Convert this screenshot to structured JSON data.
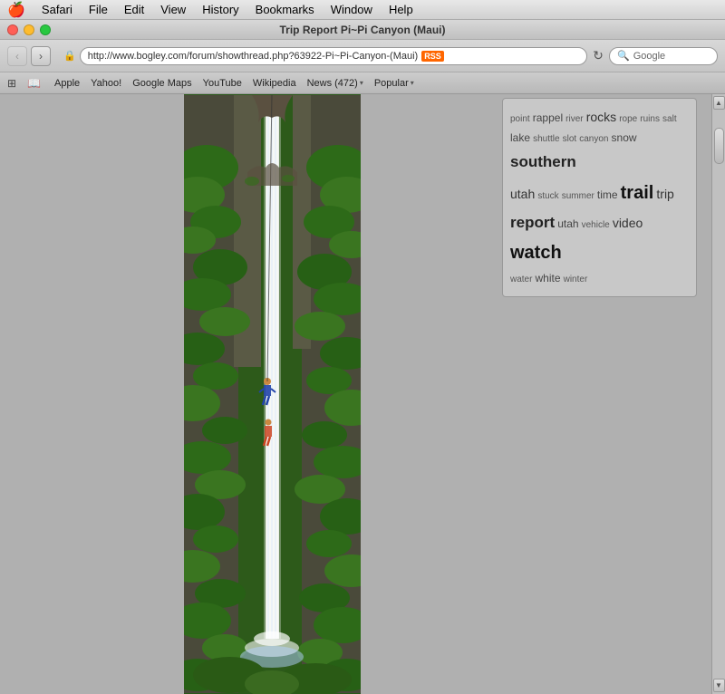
{
  "menubar": {
    "apple": "🍎",
    "items": [
      "Safari",
      "File",
      "Edit",
      "View",
      "History",
      "Bookmarks",
      "Window",
      "Help"
    ]
  },
  "titlebar": {
    "title": "Trip Report Pi~Pi Canyon (Maui)"
  },
  "toolbar": {
    "back_label": "‹",
    "forward_label": "›",
    "address": "http://www.bogley.com/forum/showthread.php?63922-Pi~Pi-Canyon-(Maui)",
    "rss_label": "RSS",
    "refresh_label": "↻",
    "search_placeholder": "Google",
    "search_icon": "🔍"
  },
  "bookmarks": {
    "icons": [
      "⊞",
      "📖"
    ],
    "items": [
      "Apple",
      "Yahoo!",
      "Google Maps",
      "YouTube",
      "Wikipedia"
    ],
    "dropdown_items": [
      {
        "label": "News (472)",
        "has_dropdown": true
      },
      {
        "label": "Popular",
        "has_dropdown": true
      }
    ]
  },
  "tag_cloud": {
    "tags": [
      {
        "word": "point",
        "size": "sm"
      },
      {
        "word": "rappel",
        "size": "md"
      },
      {
        "word": "river",
        "size": "sm"
      },
      {
        "word": "rocks",
        "size": "lg"
      },
      {
        "word": "rope",
        "size": "sm"
      },
      {
        "word": "ruins",
        "size": "sm"
      },
      {
        "word": "salt",
        "size": "sm"
      },
      {
        "word": "lake",
        "size": "md"
      },
      {
        "word": "shuttle",
        "size": "sm"
      },
      {
        "word": "slot",
        "size": "sm"
      },
      {
        "word": "canyon",
        "size": "sm"
      },
      {
        "word": "snow",
        "size": "md"
      },
      {
        "word": "southern",
        "size": "xl"
      },
      {
        "word": "utah",
        "size": "lg"
      },
      {
        "word": "stuck",
        "size": "sm"
      },
      {
        "word": "summer",
        "size": "sm"
      },
      {
        "word": "time",
        "size": "md"
      },
      {
        "word": "trail",
        "size": "xxl"
      },
      {
        "word": "trip",
        "size": "lg"
      },
      {
        "word": "report",
        "size": "xl"
      },
      {
        "word": "utah",
        "size": "md"
      },
      {
        "word": "vehicle",
        "size": "sm"
      },
      {
        "word": "video",
        "size": "lg"
      },
      {
        "word": "watch",
        "size": "xxl"
      },
      {
        "word": "water",
        "size": "sm"
      },
      {
        "word": "white",
        "size": "md"
      },
      {
        "word": "winter",
        "size": "sm"
      }
    ]
  },
  "waterfall": {
    "description": "Waterfall with person rappelling"
  }
}
